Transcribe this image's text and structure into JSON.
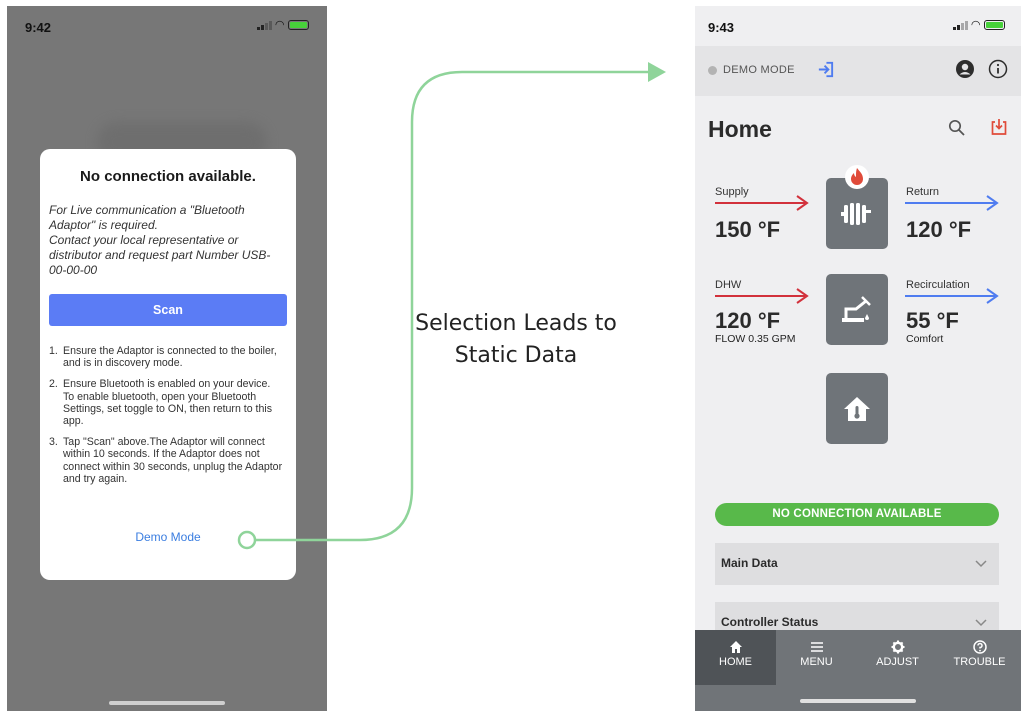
{
  "left_phone": {
    "time": "9:42",
    "dialog": {
      "title": "No connection available.",
      "description": "For Live communication a \"Bluetooth Adaptor\" is required.\nContact your local representative or distributor and request part Number USB-00-00-00",
      "scan_label": "Scan",
      "steps": [
        {
          "num": "1.",
          "text": "Ensure the Adaptor is connected to the boiler, and is in discovery mode.",
          "sub": ""
        },
        {
          "num": "2.",
          "text": "Ensure Bluetooth is enabled on your device.",
          "sub": "To enable bluetooth, open your Bluetooth Settings, set toggle to ON, then return to this app."
        },
        {
          "num": "3.",
          "text": "Tap \"Scan\" above.The Adaptor will connect within 10 seconds. If the Adaptor does not connect within 30 seconds, unplug the Adaptor and try again.",
          "sub": ""
        }
      ],
      "demo_label": "Demo Mode"
    }
  },
  "caption": "Selection Leads to Static Data",
  "right_phone": {
    "time": "9:43",
    "demo_label": "DEMO MODE",
    "page_title": "Home",
    "supply": {
      "label": "Supply",
      "value": "150 °F"
    },
    "return": {
      "label": "Return",
      "value": "120 °F"
    },
    "dhw": {
      "label": "DHW",
      "value": "120 °F",
      "sub": "FLOW 0.35 GPM"
    },
    "recirculation": {
      "label": "Recirculation",
      "value": "55 °F",
      "sub": "Comfort"
    },
    "connection_status": "NO CONNECTION AVAILABLE",
    "sections": [
      {
        "label": "Main Data"
      },
      {
        "label": "Controller Status"
      }
    ],
    "tabs": [
      {
        "label": "HOME",
        "icon": "home-icon"
      },
      {
        "label": "MENU",
        "icon": "menu-icon"
      },
      {
        "label": "ADJUST",
        "icon": "gear-icon"
      },
      {
        "label": "TROUBLE",
        "icon": "help-icon"
      }
    ]
  },
  "colors": {
    "accent_blue": "#5b7cf5",
    "connector_green": "#8fd49a",
    "status_green": "#58b94a",
    "hot_red": "#d2313c",
    "cold_blue": "#4f7cf0"
  }
}
